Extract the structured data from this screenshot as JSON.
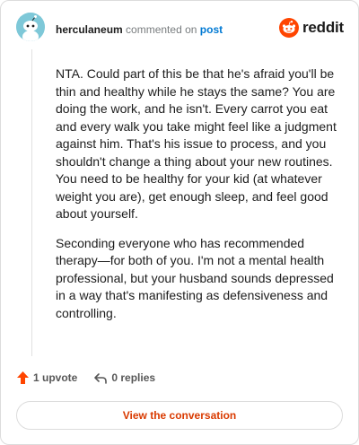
{
  "header": {
    "username": "herculaneum",
    "commented_on": "commented on",
    "post_link": "post"
  },
  "brand": {
    "name": "reddit",
    "color": "#ff4500"
  },
  "comment": {
    "paragraphs": [
      "NTA. Could part of this be that he's afraid you'll be thin and healthy while he stays the same? You are doing the work, and he isn't. Every carrot you eat and every walk you take might feel like a judgment against him. That's his issue to process, and you shouldn't change a thing about your new routines. You need to be healthy for your kid (at whatever weight you are), get enough sleep, and feel good about yourself.",
      "Seconding everyone who has recommended therapy—for both of you. I'm not a mental health professional, but your husband sounds depressed in a way that's manifesting as defensiveness and controlling."
    ]
  },
  "actions": {
    "upvote_label": "1 upvote",
    "replies_label": "0 replies"
  },
  "footer": {
    "view_label": "View the conversation"
  },
  "icons": {
    "avatar": "snoo-avatar-icon",
    "logo": "reddit-logo-icon",
    "upvote": "upvote-arrow-icon",
    "reply": "reply-arrow-icon"
  },
  "colors": {
    "upvote": "#ff4500",
    "link": "#0079d3",
    "button_text": "#d93a00"
  }
}
